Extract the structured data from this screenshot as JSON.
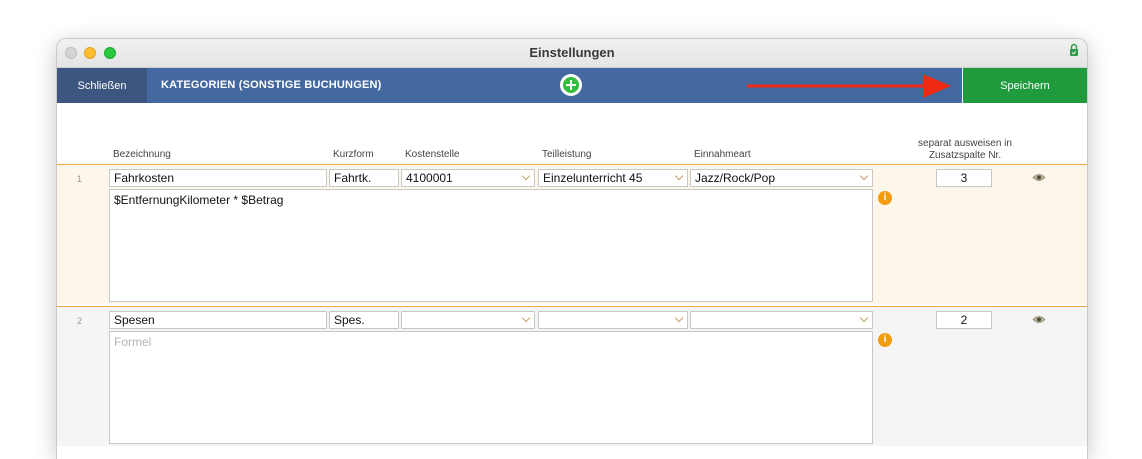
{
  "window": {
    "title": "Einstellungen"
  },
  "toolbar": {
    "close_label": "Schließen",
    "section_title": "KATEGORIEN (SONSTIGE BUCHUNGEN)",
    "save_label": "Speichern",
    "colors": {
      "bar": "#4469a0",
      "close": "#3d5680",
      "save": "#1f9a3c",
      "add": "#2fbf3c",
      "arrow": "#ee2a14"
    }
  },
  "columns": {
    "bezeichnung": "Bezeichnung",
    "kurzform": "Kurzform",
    "kostenstelle": "Kostenstelle",
    "teilleistung": "Teilleistung",
    "einnahmeart": "Einnahmeart",
    "separat_line1": "separat ausweisen in",
    "separat_line2": "Zusatzspalte Nr."
  },
  "rows": [
    {
      "number": "1",
      "bezeichnung": "Fahrkosten",
      "kurzform": "Fahrtk.",
      "kostenstelle": "4100001",
      "teilleistung": "Einzelunterricht 45",
      "einnahmeart": "Jazz/Rock/Pop",
      "formel": "$EntfernungKilometer * $Betrag",
      "zusatzspalte": "3"
    },
    {
      "number": "2",
      "bezeichnung": "Spesen",
      "kurzform": "Spes.",
      "kostenstelle": "",
      "teilleistung": "",
      "einnahmeart": "",
      "formel_placeholder": "Formel",
      "zusatzspalte": "2"
    }
  ],
  "icons": {
    "info": "info-icon",
    "eye": "eye-icon",
    "add": "plus-circle-icon",
    "lock": "lock-icon",
    "arrow": "arrow-right-icon"
  }
}
